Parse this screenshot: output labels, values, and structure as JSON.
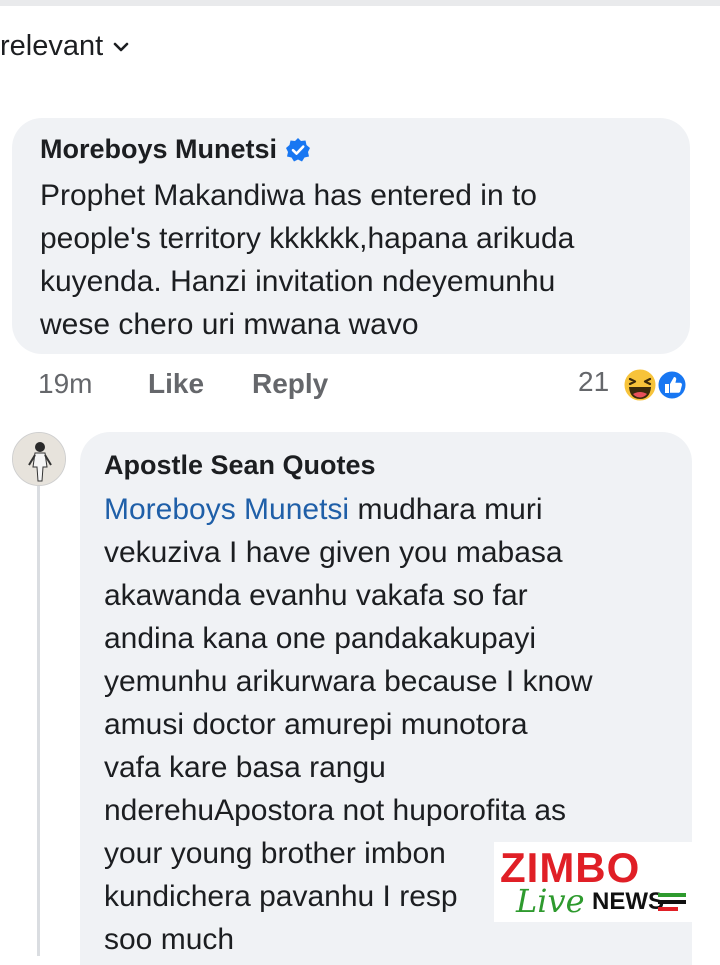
{
  "filter": {
    "label": "relevant"
  },
  "comment": {
    "author": "Moreboys Munetsi",
    "lines": [
      "Prophet Makandiwa has entered in to",
      "people's territory kkkkkk,hapana arikuda",
      "kuyenda. Hanzi invitation ndeyemunhu",
      "wese chero uri mwana wavo"
    ],
    "time": "19m",
    "like_label": "Like",
    "reply_label": "Reply",
    "reaction_count": "21",
    "reactions": [
      "haha-icon",
      "like-icon"
    ]
  },
  "reply": {
    "author": "Apostle Sean Quotes",
    "mention": "Moreboys Munetsi",
    "first_line_rest": " mudhara muri",
    "lines": [
      "vekuziva I have given you mabasa",
      "akawanda evanhu vakafa so far",
      "andina kana one pandakakupayi",
      "yemunhu arikurwara because I know",
      "amusi doctor amurepi munotora",
      "vafa kare basa rangu",
      "nderehuApostora not huporofita as",
      "your young brother imbon",
      "kundichera pavanhu I resp",
      "soo much"
    ]
  },
  "watermark": {
    "brand": "ZIMBO",
    "live": "Live",
    "news": "NEWS"
  },
  "colors": {
    "mention": "#1f5fa8",
    "bubble": "#f0f2f5",
    "verified": "#1877f2",
    "brand_red": "#e01f26",
    "brand_green": "#2e9a2e"
  }
}
